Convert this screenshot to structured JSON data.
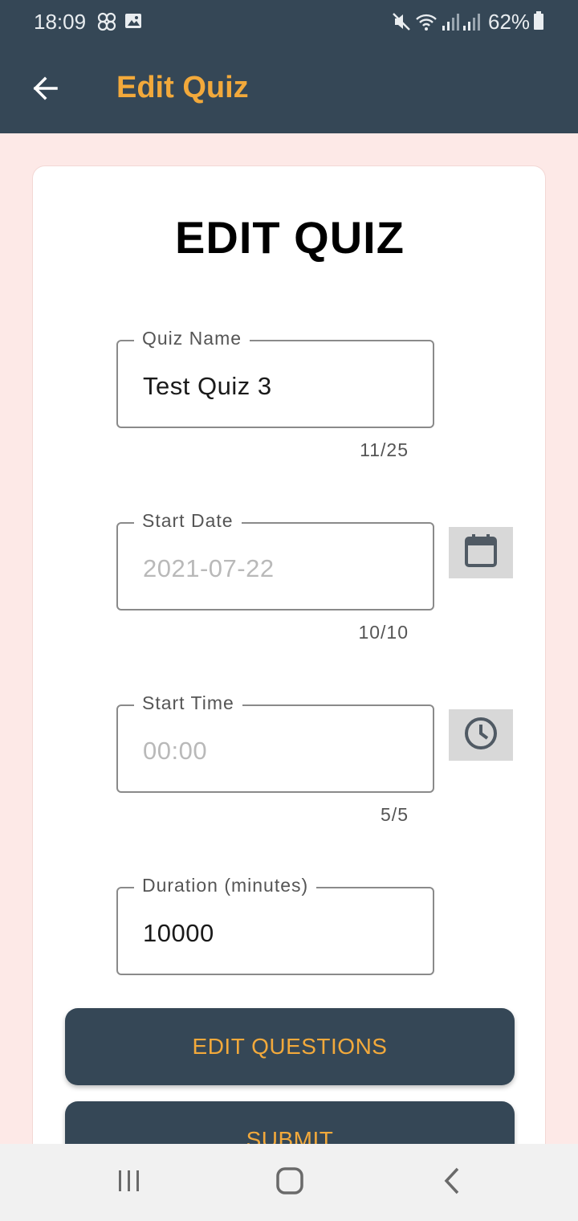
{
  "status_bar": {
    "time": "18:09",
    "icons": [
      "pinwheel-icon",
      "image-icon",
      "mute-icon",
      "wifi-icon",
      "signal-icon",
      "signal-icon",
      "battery-icon"
    ],
    "battery_percent": "62%"
  },
  "app_bar": {
    "back_icon": "arrow-back-icon",
    "title": "Edit Quiz"
  },
  "form": {
    "heading": "EDIT QUIZ",
    "quiz_name": {
      "label": "Quiz Name",
      "value": "Test Quiz 3",
      "counter": "11/25"
    },
    "start_date": {
      "label": "Start Date",
      "value": "2021-07-22",
      "counter": "10/10",
      "picker_icon": "calendar-icon"
    },
    "start_time": {
      "label": "Start Time",
      "value": "00:00",
      "counter": "5/5",
      "picker_icon": "clock-icon"
    },
    "duration": {
      "label": "Duration (minutes)",
      "value": "10000"
    },
    "edit_questions_label": "EDIT QUESTIONS",
    "submit_label": "SUBMIT"
  },
  "nav_bar": {
    "recents_icon": "recents-icon",
    "home_icon": "home-icon",
    "back_icon": "back-chevron-icon"
  },
  "colors": {
    "app_bar": "#354756",
    "accent": "#f2a93b",
    "background": "#fde9e7"
  }
}
